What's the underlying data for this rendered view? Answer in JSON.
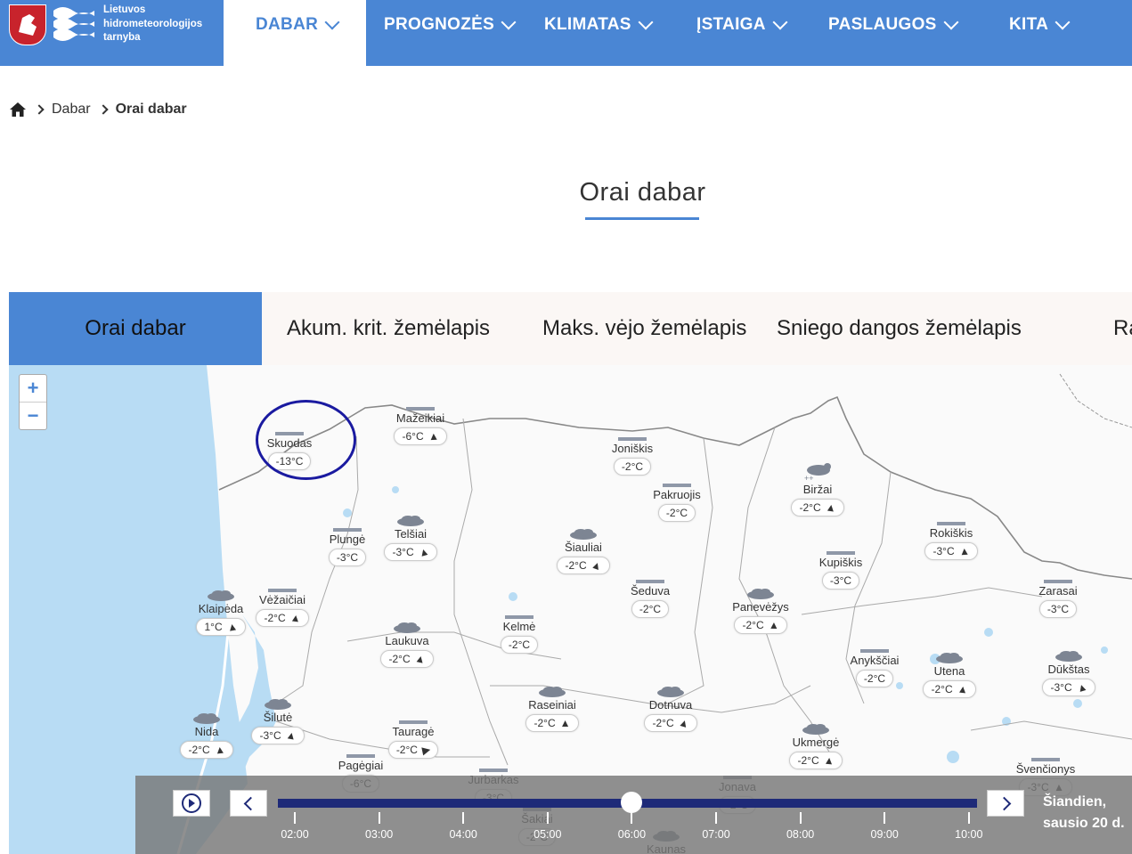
{
  "header": {
    "logo_lines": [
      "Lietuvos",
      "hidrometeorologijos",
      "tarnyba"
    ],
    "nav": [
      {
        "label": "DABAR",
        "active": true
      },
      {
        "label": "PROGNOZĖS",
        "active": false
      },
      {
        "label": "KLIMATAS",
        "active": false
      },
      {
        "label": "ĮSTAIGA",
        "active": false
      },
      {
        "label": "PASLAUGOS",
        "active": false
      },
      {
        "label": "KITA",
        "active": false
      }
    ]
  },
  "breadcrumb": {
    "items": [
      "Dabar",
      "Orai dabar"
    ]
  },
  "page": {
    "title": "Orai dabar"
  },
  "tabs": [
    "Orai dabar",
    "Akum. krit. žemėlapis",
    "Maks. vėjo žemėlapis",
    "Sniego dangos žemėlapis",
    "Ra"
  ],
  "map": {
    "zoom_in": "+",
    "zoom_out": "−",
    "stations": [
      {
        "name": "Skuodas",
        "temp": "-13°C",
        "icon": "bar",
        "wind": ""
      },
      {
        "name": "Mažeikiai",
        "temp": "-6°C",
        "icon": "bar",
        "wind": "▲"
      },
      {
        "name": "Joniškis",
        "temp": "-2°C",
        "icon": "bar",
        "wind": ""
      },
      {
        "name": "Pakruojis",
        "temp": "-2°C",
        "icon": "bar",
        "wind": ""
      },
      {
        "name": "Biržai",
        "temp": "-2°C",
        "icon": "snow-cloud",
        "wind": "▲"
      },
      {
        "name": "Telšiai",
        "temp": "-3°C",
        "icon": "cloud",
        "wind": "▲"
      },
      {
        "name": "Plungė",
        "temp": "-3°C",
        "icon": "bar",
        "wind": ""
      },
      {
        "name": "Šiauliai",
        "temp": "-2°C",
        "icon": "cloud",
        "wind": "▲"
      },
      {
        "name": "Rokiškis",
        "temp": "-3°C",
        "icon": "bar",
        "wind": "▲"
      },
      {
        "name": "Kupiškis",
        "temp": "-3°C",
        "icon": "bar",
        "wind": ""
      },
      {
        "name": "Klaipėda",
        "temp": "1°C",
        "icon": "cloud",
        "wind": "▲"
      },
      {
        "name": "Vėžaičiai",
        "temp": "-2°C",
        "icon": "bar",
        "wind": "▲"
      },
      {
        "name": "Šeduva",
        "temp": "-2°C",
        "icon": "bar",
        "wind": ""
      },
      {
        "name": "Panevėžys",
        "temp": "-2°C",
        "icon": "cloud",
        "wind": "▲"
      },
      {
        "name": "Zarasai",
        "temp": "-3°C",
        "icon": "bar",
        "wind": ""
      },
      {
        "name": "Kelmė",
        "temp": "-2°C",
        "icon": "bar",
        "wind": ""
      },
      {
        "name": "Laukuva",
        "temp": "-2°C",
        "icon": "cloud",
        "wind": "▲"
      },
      {
        "name": "Anykščiai",
        "temp": "-2°C",
        "icon": "bar",
        "wind": ""
      },
      {
        "name": "Utena",
        "temp": "-2°C",
        "icon": "cloud",
        "wind": "▲"
      },
      {
        "name": "Dūkštas",
        "temp": "-3°C",
        "icon": "cloud",
        "wind": "▲"
      },
      {
        "name": "Raseiniai",
        "temp": "-2°C",
        "icon": "cloud",
        "wind": "▲"
      },
      {
        "name": "Dotnuva",
        "temp": "-2°C",
        "icon": "cloud",
        "wind": "▲"
      },
      {
        "name": "Nida",
        "temp": "-2°C",
        "icon": "cloud",
        "wind": "▲"
      },
      {
        "name": "Šilutė",
        "temp": "-3°C",
        "icon": "cloud",
        "wind": "▲"
      },
      {
        "name": "Tauragė",
        "temp": "-2°C",
        "icon": "bar",
        "wind": "▶"
      },
      {
        "name": "Ukmergė",
        "temp": "-2°C",
        "icon": "cloud",
        "wind": "▲"
      },
      {
        "name": "Pagėgiai",
        "temp": "-6°C",
        "icon": "bar",
        "wind": ""
      },
      {
        "name": "Švenčionys",
        "temp": "-3°C",
        "icon": "bar",
        "wind": "▲"
      },
      {
        "name": "Jurbarkas",
        "temp": "-3°C",
        "icon": "bar",
        "wind": ""
      },
      {
        "name": "Jonava",
        "temp": "-2°C",
        "icon": "bar",
        "wind": ""
      },
      {
        "name": "Šakiai",
        "temp": "-2°C",
        "icon": "bar",
        "wind": ""
      },
      {
        "name": "Kaunas",
        "temp": "",
        "icon": "cloud",
        "wind": ""
      }
    ]
  },
  "timeline": {
    "times": [
      "02:00",
      "03:00",
      "04:00",
      "05:00",
      "06:00",
      "07:00",
      "08:00",
      "09:00",
      "10:00"
    ],
    "current": "06:00",
    "date_line1": "Šiandien,",
    "date_line2": "sausio 20 d."
  }
}
